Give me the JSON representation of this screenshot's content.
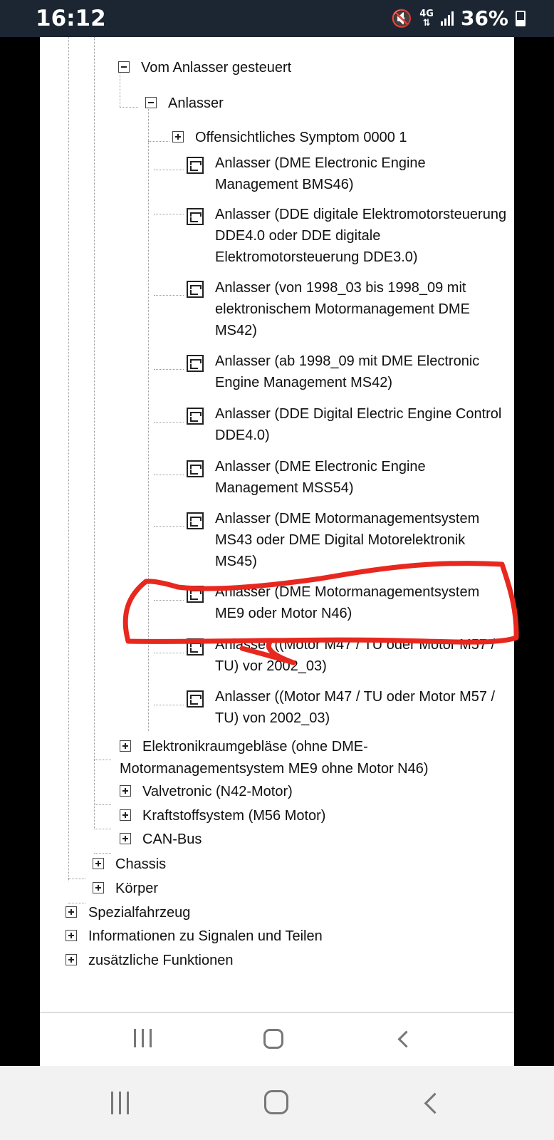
{
  "status_bar": {
    "time": "16:12",
    "network": "4G",
    "battery": "36%"
  },
  "tree": {
    "vom_anlasser": "Vom Anlasser gesteuert",
    "anlasser": "Anlasser",
    "symptom": "Offensichtliches Symptom 0000 1",
    "leaves": [
      "Anlasser (DME Electronic Engine Management BMS46)",
      "Anlasser (DDE digitale Elektromotorsteuerung DDE4.0 oder DDE digitale Elektromotorsteuerung DDE3.0)",
      "Anlasser (von 1998_03 bis 1998_09 mit elektronischem Motormanagement DME MS42)",
      "Anlasser (ab 1998_09 mit DME Electronic Engine Management MS42)",
      "Anlasser (DDE Digital Electric Engine Control DDE4.0)",
      "Anlasser (DME Electronic Engine Management MSS54)",
      "Anlasser (DME Motormanagementsystem MS43 oder DME Digital Motorelektronik MS45)",
      "Anlasser (DME Motormanagementsystem ME9 oder Motor N46)",
      "Anlasser ((Motor M47 / TU oder Motor M57 / TU) vor 2002_03)",
      "Anlasser ((Motor M47 / TU oder Motor M57 / TU) von 2002_03)"
    ],
    "elektronikraum_line1": "Elektronikraumgebläse (ohne DME-",
    "elektronikraum_line2": "Motormanagementsystem ME9 ohne Motor N46)",
    "valvetronic": "Valvetronic (N42-Motor)",
    "kraftstoff": "Kraftstoffsystem (M56 Motor)",
    "canbus": "CAN-Bus",
    "chassis": "Chassis",
    "koerper": "Körper",
    "spezial": "Spezialfahrzeug",
    "informationen": "Informationen zu Signalen und Teilen",
    "zusaetzliche": "zusätzliche Funktionen"
  },
  "annotation": {
    "color": "#e8281e"
  },
  "colors": {
    "status_bar_bg": "#1c2633",
    "page_bg": "#ffffff"
  }
}
